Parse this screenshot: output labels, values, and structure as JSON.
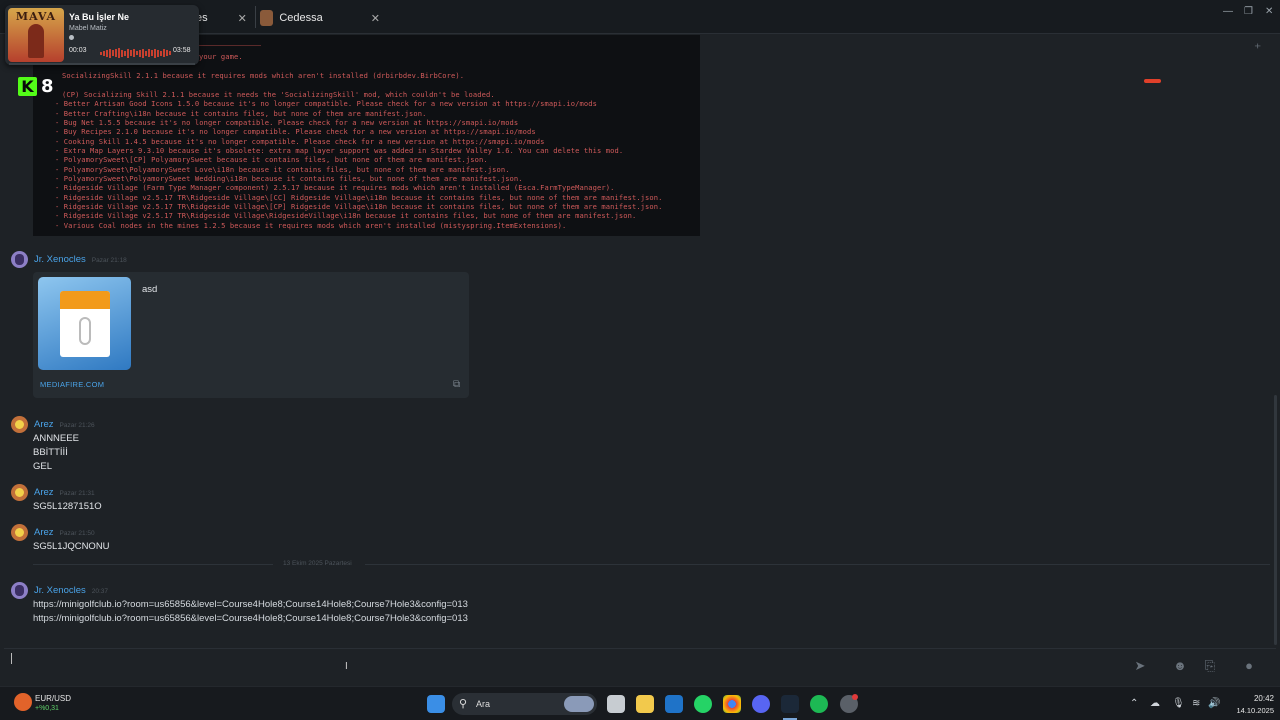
{
  "tabs": [
    {
      "label": "es",
      "close": "✕"
    },
    {
      "label": "Cedessa",
      "close": "✕"
    }
  ],
  "window_controls": {
    "minimize": "—",
    "maximize": "❐",
    "close": "✕"
  },
  "media": {
    "cover_text": "MAVA",
    "title": "Ya Bu İşler Ne",
    "artist": "Mabel Matiz",
    "elapsed": "00:03",
    "duration": "03:58"
  },
  "kick": {
    "number": "8"
  },
  "console": {
    "lines": [
      "your game.",
      "SocializingSkill 2.1.1 because it requires mods which aren't installed (drbirbdev.BirbCore).",
      "(CP) Socializing Skill 2.1.1 because it needs the 'SocializingSkill' mod, which couldn't be loaded.",
      "- Better Artisan Good Icons 1.5.0 because it's no longer compatible. Please check for a new version at https://smapi.io/mods",
      "- Better Crafting\\i18n because it contains files, but none of them are manifest.json.",
      "- Bug Net 1.5.5 because it's no longer compatible. Please check for a new version at https://smapi.io/mods",
      "- Buy Recipes 2.1.0 because it's no longer compatible. Please check for a new version at https://smapi.io/mods",
      "- Cooking Skill 1.4.5 because it's no longer compatible. Please check for a new version at https://smapi.io/mods",
      "- Extra Map Layers 9.3.10 because it's obsolete: extra map layer support was added in Stardew Valley 1.6. You can delete this mod.",
      "- PolyamorySweet\\[CP] PolyamorySweet because it contains files, but none of them are manifest.json.",
      "- PolyamorySweet\\PolyamorySweet Love\\i18n because it contains files, but none of them are manifest.json.",
      "- PolyamorySweet\\PolyamorySweet Wedding\\i18n because it contains files, but none of them are manifest.json.",
      "- Ridgeside Village (Farm Type Manager component) 2.5.17 because it requires mods which aren't installed (Esca.FarmTypeManager).",
      "- Ridgeside Village v2.5.17 TR\\Ridgeside Village\\[CC] Ridgeside Village\\i18n because it contains files, but none of them are manifest.json.",
      "- Ridgeside Village v2.5.17 TR\\Ridgeside Village\\[CP] Ridgeside Village\\i18n because it contains files, but none of them are manifest.json.",
      "- Ridgeside Village v2.5.17 TR\\Ridgeside Village\\RidgesideVillage\\i18n because it contains files, but none of them are manifest.json.",
      "- Various Coal nodes in the mines 1.2.5 because it requires mods which aren't installed (mistyspring.ItemExtensions)."
    ]
  },
  "messages": {
    "m1": {
      "author": "Jr. Xenocles",
      "time": "Pazar 21:18"
    },
    "embed": {
      "title": "asd",
      "site": "MEDIAFIRE.COM"
    },
    "m2": {
      "author": "Arez",
      "time": "Pazar 21:26",
      "lines": [
        "ANNNEEE",
        "BBİTTİİİ",
        "GEL"
      ]
    },
    "m3": {
      "author": "Arez",
      "time": "Pazar 21:31",
      "text": "SG5L1287151O"
    },
    "m4": {
      "author": "Arez",
      "time": "Pazar 21:50",
      "text": "SG5L1JQCNONU"
    },
    "date_divider": "13 Ekim 2025 Pazartesi",
    "m5": {
      "author": "Jr. Xenocles",
      "time": "20:37",
      "lines": [
        "https://minigolfclub.io?room=us65856&level=Course4Hole8;Course14Hole8;Course7Hole3&config=013",
        "https://minigolfclub.io?room=us65856&level=Course4Hole8;Course14Hole8;Course7Hole3&config=013"
      ]
    }
  },
  "input_icons": [
    "send-icon",
    "emoji-icon",
    "attach-icon",
    "mic-icon"
  ],
  "taskbar": {
    "widget_label": "EUR/USD",
    "widget_value": "+%0,31",
    "search_label": "Ara",
    "time": "20:42",
    "date": "14.10.2025"
  }
}
